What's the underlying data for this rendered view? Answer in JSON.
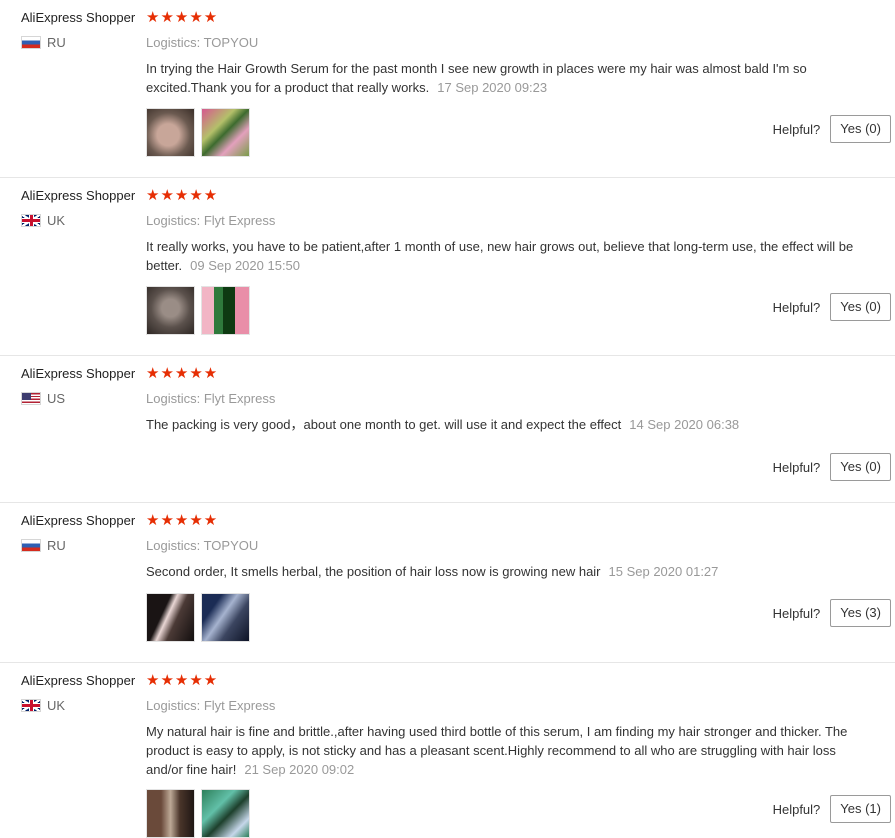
{
  "reviews": [
    {
      "user": "AliExpress Shopper",
      "country": "RU",
      "flag": "ru",
      "stars": "★★★★★",
      "rating": 5,
      "logistics_label": "Logistics:",
      "logistics": "TOPYOU",
      "text": "In trying the Hair Growth Serum for the past month I see new growth in places were my hair was almost bald I'm so excited.Thank you for a product that really works.",
      "date": "17 Sep 2020 09:23",
      "helpful_label": "Helpful?",
      "yes_label": "Yes (0)"
    },
    {
      "user": "AliExpress Shopper",
      "country": "UK",
      "flag": "uk",
      "stars": "★★★★★",
      "rating": 5,
      "logistics_label": "Logistics:",
      "logistics": "Flyt Express",
      "text": "It really works, you have to be patient,after 1 month of use, new hair grows out, believe that long-term use, the effect will be better.",
      "date": "09 Sep 2020 15:50",
      "helpful_label": "Helpful?",
      "yes_label": "Yes (0)"
    },
    {
      "user": "AliExpress Shopper",
      "country": "US",
      "flag": "us",
      "stars": "★★★★★",
      "rating": 5,
      "logistics_label": "Logistics:",
      "logistics": "Flyt Express",
      "text": "The packing is very good，about one month to get. will use it and expect the effect",
      "date": "14 Sep 2020 06:38",
      "helpful_label": "Helpful?",
      "yes_label": "Yes (0)"
    },
    {
      "user": "AliExpress Shopper",
      "country": "RU",
      "flag": "ru",
      "stars": "★★★★★",
      "rating": 5,
      "logistics_label": "Logistics:",
      "logistics": "TOPYOU",
      "text": "Second order, It smells herbal, the position of hair loss now is growing new hair",
      "date": "15 Sep 2020 01:27",
      "helpful_label": "Helpful?",
      "yes_label": "Yes (3)"
    },
    {
      "user": "AliExpress Shopper",
      "country": "UK",
      "flag": "uk",
      "stars": "★★★★★",
      "rating": 5,
      "logistics_label": "Logistics:",
      "logistics": "Flyt Express",
      "text": "My natural hair is fine and brittle.,after having used third bottle of this serum, I am finding my hair stronger and thicker. The product is easy to apply, is not sticky and has a pleasant scent.Highly recommend to all who are struggling with hair loss and/or fine hair!",
      "date": "21 Sep 2020 09:02",
      "helpful_label": "Helpful?",
      "yes_label": "Yes (1)"
    }
  ],
  "colors": {
    "star": "#e62e04",
    "muted": "#999999",
    "text": "#333333",
    "divider": "#e6e6e6"
  }
}
